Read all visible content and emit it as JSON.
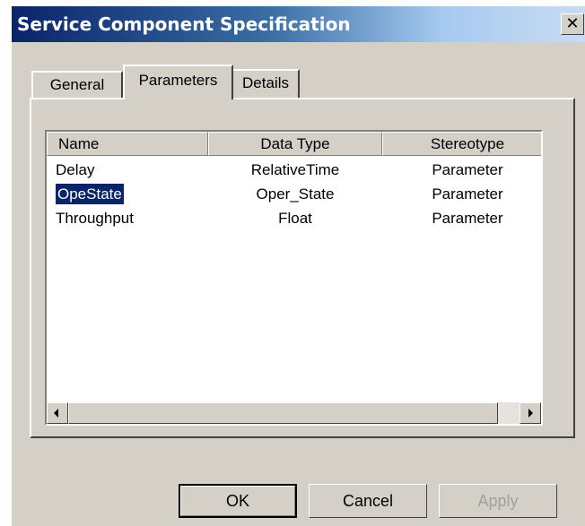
{
  "window": {
    "title": "Service Component Specification",
    "close_glyph": "✕"
  },
  "tabs": [
    {
      "label": "General",
      "selected": false
    },
    {
      "label": "Parameters",
      "selected": true
    },
    {
      "label": "Details",
      "selected": false
    }
  ],
  "list": {
    "columns": [
      "Name",
      "Data Type",
      "Stereotype"
    ],
    "rows": [
      {
        "name": "Delay",
        "data_type": "RelativeTime",
        "stereotype": "Parameter",
        "selected": false
      },
      {
        "name": "OpeState",
        "data_type": "Oper_State",
        "stereotype": "Parameter",
        "selected": true
      },
      {
        "name": "Throughput",
        "data_type": "Float",
        "stereotype": "Parameter",
        "selected": false
      }
    ]
  },
  "buttons": {
    "ok": "OK",
    "cancel": "Cancel",
    "apply": "Apply",
    "apply_enabled": false
  },
  "colors": {
    "title_gradient_start": "#0a246a",
    "title_gradient_end": "#a6caf0",
    "selection": "#0a246a",
    "dialog_face": "#d4d0c8"
  }
}
